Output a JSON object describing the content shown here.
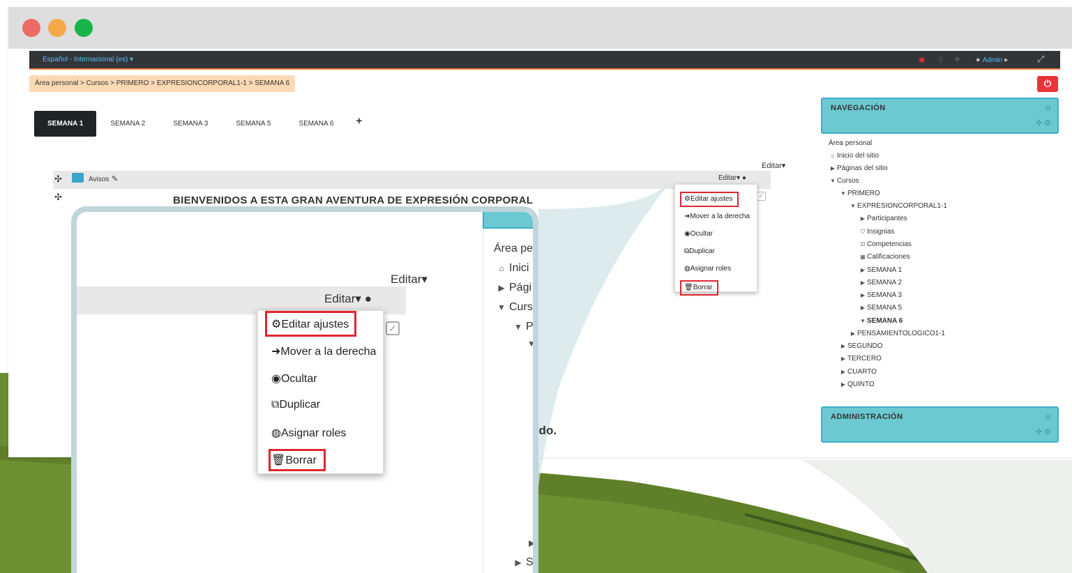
{
  "navbar": {
    "language": "Español - Internacional (es)",
    "user": "Admin"
  },
  "breadcrumb": [
    "Área personal",
    "Cursos",
    "PRIMERO",
    "EXPRESIONCORPORAL1-1",
    "SEMANA 6"
  ],
  "tabs": [
    {
      "label": "SEMANA 1",
      "active": true
    },
    {
      "label": "SEMANA 2",
      "active": false
    },
    {
      "label": "SEMANA 3",
      "active": false
    },
    {
      "label": "SEMANA 5",
      "active": false
    },
    {
      "label": "SEMANA 6",
      "active": false
    }
  ],
  "tab_add": "+",
  "course": {
    "editar_label": "Editar",
    "avisos_label": "Avisos",
    "welcome": "BIENVENIDOS A ESTA GRAN AVENTURA DE EXPRESIÓN CORPORAL",
    "periodo_text": "ara este periodo."
  },
  "dropdown_menu": {
    "items": [
      "Editar ajustes",
      "Mover a la derecha",
      "Ocultar",
      "Duplicar",
      "Asignar roles",
      "Borrar"
    ],
    "highlighted": [
      "Editar ajustes",
      "Borrar"
    ],
    "highlight_color": "#e0262f"
  },
  "navigation": {
    "title": "NAVEGACIÓN",
    "items": [
      "Área personal",
      "Inicio del sitio",
      "Páginas del sitio",
      "Cursos",
      "PRIMERO",
      "EXPRESIONCORPORAL1-1",
      "Participantes",
      "Insignias",
      "Competencias",
      "Calificaciones",
      "SEMANA 1",
      "SEMANA 2",
      "SEMANA 3",
      "SEMANA 5",
      "SEMANA 6",
      "PENSAMIENTOLOGICO1-1",
      "SEGUNDO",
      "TERCERO",
      "CUARTO",
      "QUINTO"
    ]
  },
  "administration": {
    "title": "ADMINISTRACIÓN"
  },
  "zoom_nav": {
    "items": [
      "Área per",
      "Inici",
      "Pági",
      "Curs",
      "P",
      "S"
    ]
  },
  "colors": {
    "accent_teal": "#6cc8d1",
    "navbar_bg": "#333438",
    "link_blue": "#4fc3f7",
    "danger_red": "#e8333a",
    "breadcrumb_bg": "#fbd9b3",
    "background_green": "#6b8f2c"
  }
}
